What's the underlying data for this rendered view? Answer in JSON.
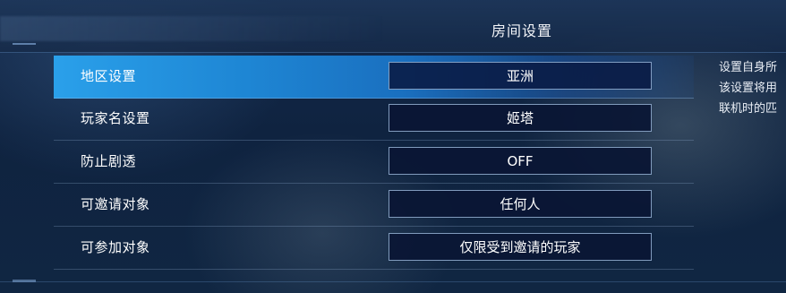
{
  "panel": {
    "title": "房间设置"
  },
  "settings": [
    {
      "label": "地区设置",
      "value": "亚洲",
      "selected": true
    },
    {
      "label": "玩家名设置",
      "value": "姬塔",
      "selected": false
    },
    {
      "label": "防止剧透",
      "value": "OFF",
      "selected": false
    },
    {
      "label": "可邀请对象",
      "value": "任何人",
      "selected": false
    },
    {
      "label": "可参加对象",
      "value": "仅限受到邀请的玩家",
      "selected": false
    }
  ],
  "description": {
    "lines": [
      "设置自身所",
      "该设置将用",
      "联机时的匹"
    ]
  },
  "colors": {
    "selected_row": "#1e86d4",
    "value_box_bg": "#0a1634",
    "text": "#ffffff"
  }
}
